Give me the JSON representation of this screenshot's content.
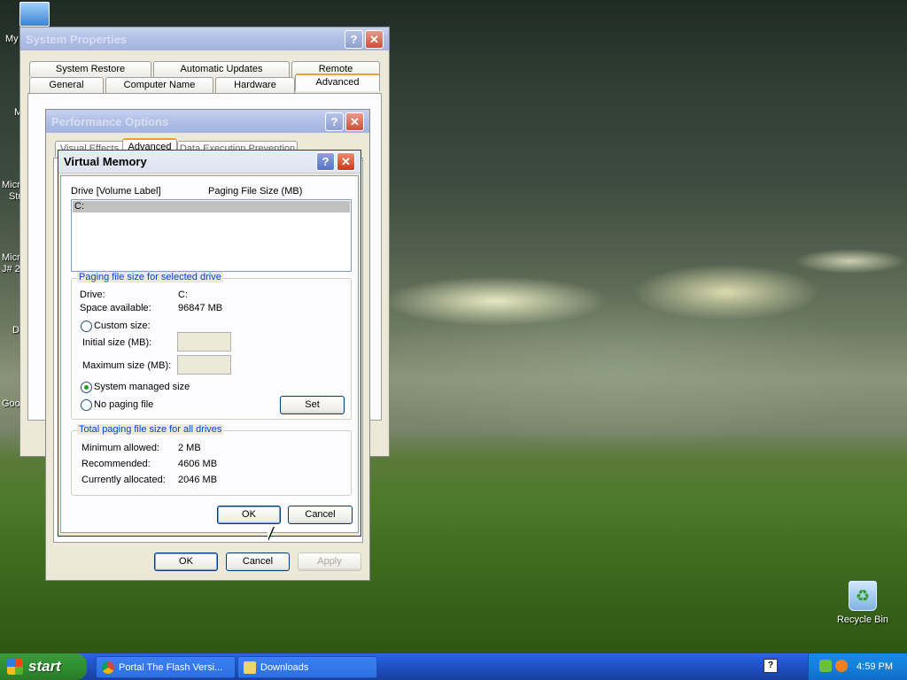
{
  "desktop": {
    "icons": [
      {
        "label": "Recycle Bin"
      }
    ],
    "left_edge_labels": [
      "My",
      "M",
      "Micr",
      "Stu",
      "Micr",
      "J# 2",
      "D",
      "Goo"
    ]
  },
  "system_properties": {
    "title": "System Properties",
    "tabs_row1": [
      "System Restore",
      "Automatic Updates",
      "Remote"
    ],
    "tabs_row2": [
      "General",
      "Computer Name",
      "Hardware",
      "Advanced"
    ],
    "selected_tab": "Advanced"
  },
  "performance_options": {
    "title": "Performance Options",
    "tabs": [
      "Visual Effects",
      "Advanced",
      "Data Execution Prevention"
    ],
    "selected_tab": "Advanced",
    "buttons": {
      "ok": "OK",
      "cancel": "Cancel",
      "apply": "Apply"
    }
  },
  "virtual_memory": {
    "title": "Virtual Memory",
    "list_header": {
      "drive": "Drive  [Volume Label]",
      "size": "Paging File Size (MB)"
    },
    "drives": [
      {
        "drive": "C:",
        "size": ""
      }
    ],
    "selected_drive_group": {
      "title": "Paging file size for selected drive",
      "drive_label": "Drive:",
      "drive_value": "C:",
      "space_label": "Space available:",
      "space_value": "96847 MB",
      "custom_size": "Custom size:",
      "initial_size": "Initial size (MB):",
      "initial_value": "",
      "maximum_size": "Maximum size (MB):",
      "maximum_value": "",
      "system_managed": "System managed size",
      "no_paging": "No paging file",
      "selected_option": "System managed size",
      "set_button": "Set"
    },
    "total_group": {
      "title": "Total paging file size for all drives",
      "min_label": "Minimum allowed:",
      "min_value": "2 MB",
      "rec_label": "Recommended:",
      "rec_value": "4606 MB",
      "alloc_label": "Currently allocated:",
      "alloc_value": "2046 MB"
    },
    "buttons": {
      "ok": "OK",
      "cancel": "Cancel"
    }
  },
  "taskbar": {
    "start_label": "start",
    "tasks": [
      {
        "label": "Portal The Flash Versi...",
        "icon": "chrome-icon"
      },
      {
        "label": "Downloads",
        "icon": "folder-icon"
      }
    ],
    "clock": "4:59 PM",
    "language_indicator": "?"
  }
}
